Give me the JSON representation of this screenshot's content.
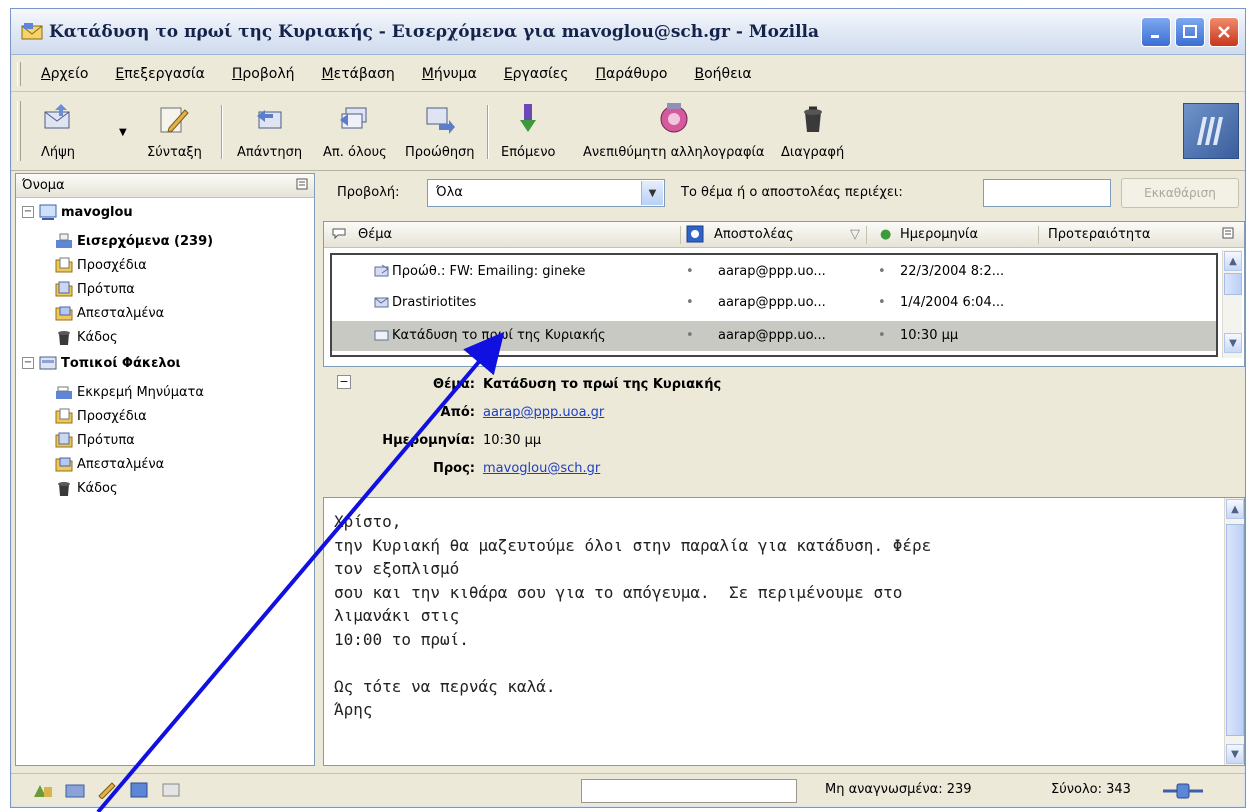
{
  "window": {
    "title": "Κατάδυση το πρωί της Κυριακής - Εισερχόμενα για mavoglou@sch.gr - Mozilla",
    "controls": [
      "minimize",
      "maximize",
      "close"
    ]
  },
  "menu": {
    "items": [
      "Αρχείο",
      "Επεξεργασία",
      "Προβολή",
      "Μετάβαση",
      "Μήνυμα",
      "Εργασίες",
      "Παράθυρο",
      "Βοήθεια"
    ]
  },
  "toolbar": {
    "get": "Λήψη",
    "compose": "Σύνταξη",
    "reply": "Απάντηση",
    "reply_all": "Απ. όλους",
    "forward": "Προώθηση",
    "next": "Επόμενο",
    "junk": "Ανεπιθύμητη αλληλογραφία",
    "delete": "Διαγραφή"
  },
  "folders": {
    "header": "Όνομα",
    "account": "mavoglou",
    "account_items": [
      {
        "label": "Εισερχόμενα (239)",
        "icon": "inbox-icon",
        "bold": true
      },
      {
        "label": "Προσχέδια",
        "icon": "drafts-icon"
      },
      {
        "label": "Πρότυπα",
        "icon": "templates-icon"
      },
      {
        "label": "Απεσταλμένα",
        "icon": "sent-icon"
      },
      {
        "label": "Κάδος",
        "icon": "trash-icon"
      }
    ],
    "local": "Τοπικοί Φάκελοι",
    "local_items": [
      {
        "label": "Εκκρεμή Μηνύματα",
        "icon": "outbox-icon"
      },
      {
        "label": "Προσχέδια",
        "icon": "drafts-icon"
      },
      {
        "label": "Πρότυπα",
        "icon": "templates-icon"
      },
      {
        "label": "Απεσταλμένα",
        "icon": "sent-icon"
      },
      {
        "label": "Κάδος",
        "icon": "trash-icon"
      }
    ]
  },
  "filter": {
    "view_label": "Προβολή:",
    "view_value": "Όλα",
    "search_label": "Το θέμα ή ο αποστολέας περιέχει:",
    "search_value": "",
    "clear_button": "Εκκαθάριση"
  },
  "message_list": {
    "columns": {
      "subject": "Θέμα",
      "sender": "Αποστολέας",
      "date": "Ημερομηνία",
      "priority": "Προτεραιότητα"
    },
    "rows": [
      {
        "subject": "Προώθ.: FW: Emailing: gineke",
        "sender": "aarap@ppp.uo...",
        "date": "22/3/2004 8:2..."
      },
      {
        "subject": "Drastiriotites",
        "sender": "aarap@ppp.uo...",
        "date": "1/4/2004 6:04..."
      },
      {
        "subject": "Κατάδυση το πρωί της Κυριακής",
        "sender": "aarap@ppp.uo...",
        "date": "10:30 μμ",
        "selected": true
      }
    ]
  },
  "message": {
    "subject_label": "Θέμα:",
    "subject": "Κατάδυση το πρωί της Κυριακής",
    "from_label": "Από:",
    "from": "aarap@ppp.uoa.gr",
    "date_label": "Ημερομηνία:",
    "date": "10:30 μμ",
    "to_label": "Προς:",
    "to": "mavoglou@sch.gr",
    "body": "Χρίστο,\nτην Κυριακή θα μαζευτούμε όλοι στην παραλία για κατάδυση. Φέρε\nτον εξοπλισμό\nσου και την κιθάρα σου για το απόγευμα.  Σε περιμένουμε στο\nλιμανάκι στις\n10:00 το πρωί.\n\nΩς τότε να περνάς καλά.\nΆρης"
  },
  "status": {
    "unread": "Μη αναγνωσμένα: 239",
    "total": "Σύνολο: 343"
  },
  "colors": {
    "window_bg": "#ece9d8",
    "link": "#1f3fbf",
    "annotation_arrow": "#1010e0",
    "selection": "#c9c9c4"
  }
}
